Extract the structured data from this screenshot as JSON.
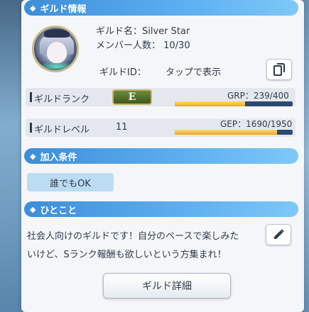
{
  "guild_info": {
    "header": "ギルド情報",
    "name_line": "ギルド名：Silver Star",
    "members_line": "メンバー人数： 10/30",
    "id_label": "ギルドID：",
    "id_value": "タップで表示"
  },
  "rank_row": {
    "label": "ギルドランク",
    "rank": "E",
    "points_text": "GRP：239/400",
    "progress": 0.5975
  },
  "level_row": {
    "label": "ギルドレベル",
    "level": "11",
    "points_text": "GEP：1690/1950",
    "progress": 0.8667
  },
  "join": {
    "header": "加入条件",
    "condition": "誰でもOK"
  },
  "comment": {
    "header": "ひとこと",
    "line1": "社会人向けのギルドです！自分のペースで楽しみた",
    "line2": "いけど、Sランク報酬も欲しいという方集まれ！"
  },
  "detail_button": "ギルド詳細",
  "icons": {
    "section": "diamond-icon",
    "copy": "copy-icon",
    "edit": "pencil-icon"
  },
  "colors": {
    "header_blue": "#3d8ed8",
    "progress_fill": "#e6a92c",
    "chip_blue": "#bcdcf3"
  }
}
